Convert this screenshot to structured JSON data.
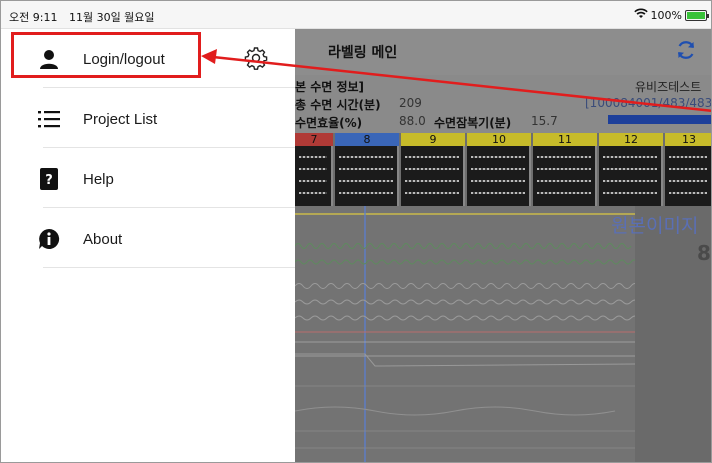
{
  "status_bar": {
    "time": "오전 9:11",
    "date": "11월 30일 월요일",
    "battery": "100%",
    "battery_level": 1.0
  },
  "sidebar": {
    "items": [
      {
        "label": "Login/logout",
        "icon": "person-icon"
      },
      {
        "label": "Project List",
        "icon": "list-icon"
      },
      {
        "label": "Help",
        "icon": "help-book-icon"
      },
      {
        "label": "About",
        "icon": "info-icon"
      }
    ],
    "settings_icon": "gear-icon"
  },
  "main": {
    "title": "라벨링 메인",
    "refresh_icon": "refresh-icon",
    "info": {
      "section_title": "본 수면 정보]",
      "total_sleep_label": "총 수면 시간(분)",
      "total_sleep_value": "209",
      "efficiency_label": "수면효율(%)",
      "efficiency_value": "88.0",
      "latency_label": "수면잠복기(분)",
      "latency_value": "15.7",
      "project_name": "유비즈테스트",
      "project_progress": "[100084001/483/483"
    },
    "epochs": [
      "7",
      "8",
      "9",
      "10",
      "11",
      "12",
      "13"
    ],
    "watermark": "원본이미지",
    "watermark_number": "8"
  },
  "colors": {
    "highlight_box": "#e11d1d",
    "epoch_red": "#c0392b",
    "epoch_blue": "#2f6fd6",
    "epoch_yellow": "#d8c81c"
  }
}
